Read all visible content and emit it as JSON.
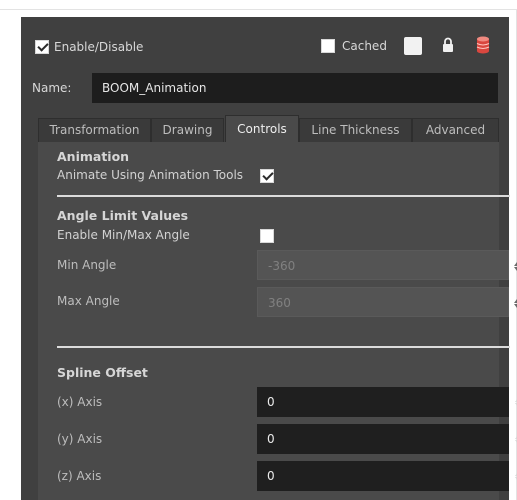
{
  "header": {
    "enable_label": "Enable/Disable",
    "enable_checked": true,
    "cached_label": "Cached",
    "cached_checked": false
  },
  "name": {
    "label": "Name:",
    "value": "BOOM_Animation"
  },
  "tabs": [
    {
      "label": "Transformation",
      "active": false
    },
    {
      "label": "Drawing",
      "active": false
    },
    {
      "label": "Controls",
      "active": true
    },
    {
      "label": "Line Thickness",
      "active": false
    },
    {
      "label": "Advanced",
      "active": false
    }
  ],
  "animation": {
    "title": "Animation",
    "animate_tools_label": "Animate Using Animation Tools",
    "animate_tools_checked": true
  },
  "angle_limit": {
    "title": "Angle Limit Values",
    "enable_label": "Enable Min/Max Angle",
    "enable_checked": false,
    "min_label": "Min Angle",
    "min_value": "-360",
    "max_label": "Max Angle",
    "max_value": "360"
  },
  "spline_offset": {
    "title": "Spline Offset",
    "x_label": "(x) Axis",
    "x_value": "0",
    "y_label": "(y) Axis",
    "y_value": "0",
    "z_label": "(z) Axis",
    "z_value": "0"
  },
  "colors": {
    "panel_bg": "#404040",
    "tab_content_bg": "#4a4a4a",
    "field_bg": "#1f1f1f",
    "lock_icon": "#f0f0f0",
    "database_icon": "#d9473f"
  }
}
